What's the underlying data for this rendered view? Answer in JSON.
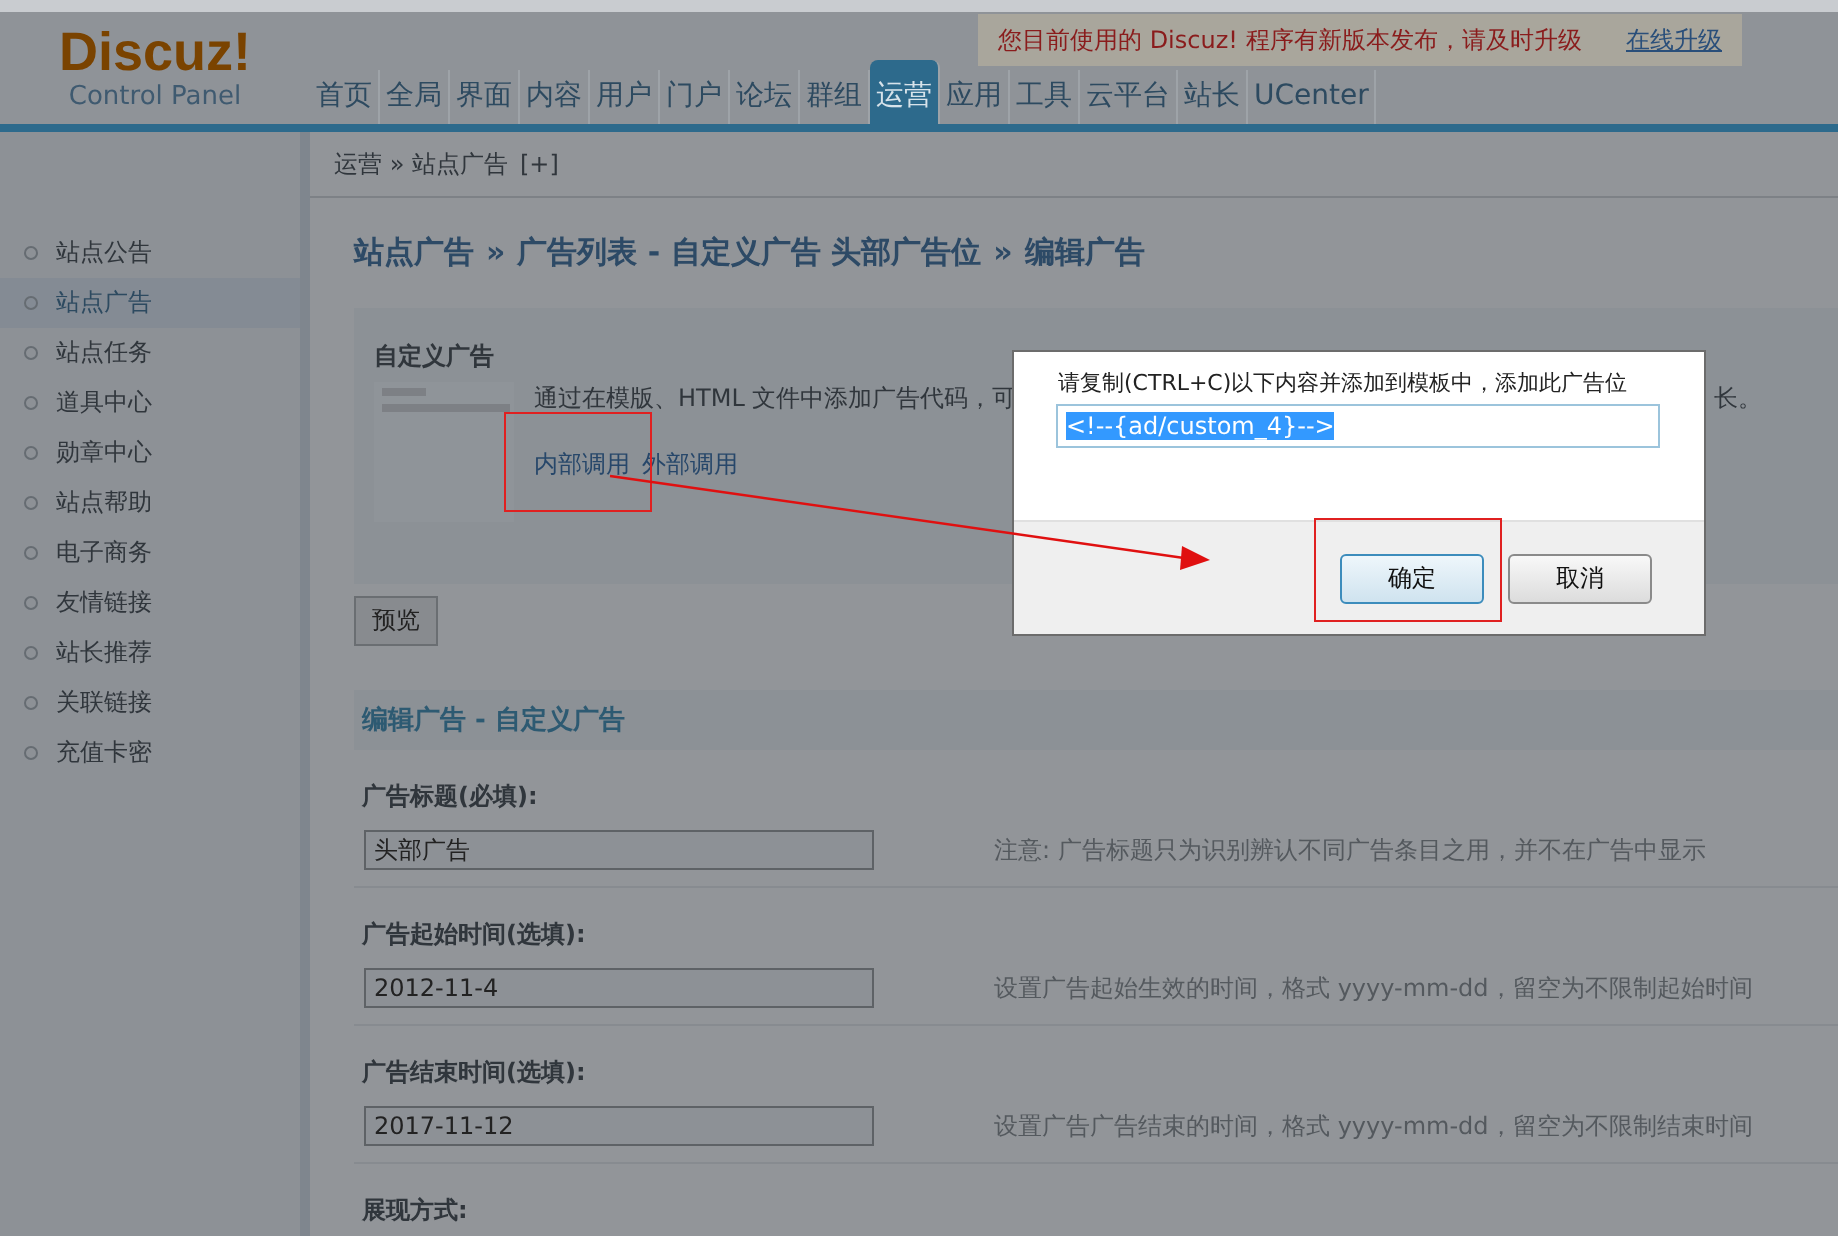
{
  "logo": {
    "title": "Discuz!",
    "subtitle": "Control Panel"
  },
  "nav": [
    {
      "label": "首页",
      "selected": false
    },
    {
      "label": "全局",
      "selected": false
    },
    {
      "label": "界面",
      "selected": false
    },
    {
      "label": "内容",
      "selected": false
    },
    {
      "label": "用户",
      "selected": false
    },
    {
      "label": "门户",
      "selected": false
    },
    {
      "label": "论坛",
      "selected": false
    },
    {
      "label": "群组",
      "selected": false
    },
    {
      "label": "运营",
      "selected": true
    },
    {
      "label": "应用",
      "selected": false
    },
    {
      "label": "工具",
      "selected": false
    },
    {
      "label": "云平台",
      "selected": false
    },
    {
      "label": "站长",
      "selected": false
    },
    {
      "label": "UCenter",
      "selected": false
    }
  ],
  "notice": {
    "text": "您目前使用的 Discuz! 程序有新版本发布，请及时升级",
    "link": "在线升级"
  },
  "breadcrumb": {
    "text": "运营 » 站点广告",
    "add": "[+]"
  },
  "sidebar": {
    "items": [
      {
        "label": "站点公告",
        "selected": false
      },
      {
        "label": "站点广告",
        "selected": true
      },
      {
        "label": "站点任务",
        "selected": false
      },
      {
        "label": "道具中心",
        "selected": false
      },
      {
        "label": "勋章中心",
        "selected": false
      },
      {
        "label": "站点帮助",
        "selected": false
      },
      {
        "label": "电子商务",
        "selected": false
      },
      {
        "label": "友情链接",
        "selected": false
      },
      {
        "label": "站长推荐",
        "selected": false
      },
      {
        "label": "关联链接",
        "selected": false
      },
      {
        "label": "充值卡密",
        "selected": false
      }
    ]
  },
  "page_title": {
    "parts": [
      "站点广告",
      "广告列表 - 自定义广告 头部广告位",
      "编辑广告"
    ],
    "separator": "»"
  },
  "ad_type": {
    "title": "自定义广告",
    "description": "通过在模版、HTML 文件中添加广告代码，可",
    "description_end": "长。",
    "links": [
      "内部调用",
      "外部调用"
    ]
  },
  "preview_button": "预览",
  "edit_section": {
    "title": "编辑广告 - 自定义广告",
    "fields": [
      {
        "label": "广告标题(必填):",
        "value": "头部广告",
        "hint": "注意: 广告标题只为识别辨认不同广告条目之用，并不在广告中显示"
      },
      {
        "label": "广告起始时间(选填):",
        "value": "2012-11-4",
        "hint": "设置广告起始生效的时间，格式 yyyy-mm-dd，留空为不限制起始时间"
      },
      {
        "label": "广告结束时间(选填):",
        "value": "2017-11-12",
        "hint": "设置广告广告结束的时间，格式 yyyy-mm-dd，留空为不限制结束时间"
      }
    ],
    "next_label": "展现方式:"
  },
  "dialog": {
    "message": "请复制(CTRL+C)以下内容并添加到模板中，添加此广告位",
    "code": "<!--{ad/custom_4}-->",
    "buttons": [
      {
        "label": "确定",
        "kind": "primary"
      },
      {
        "label": "取消",
        "kind": "secondary"
      }
    ]
  }
}
